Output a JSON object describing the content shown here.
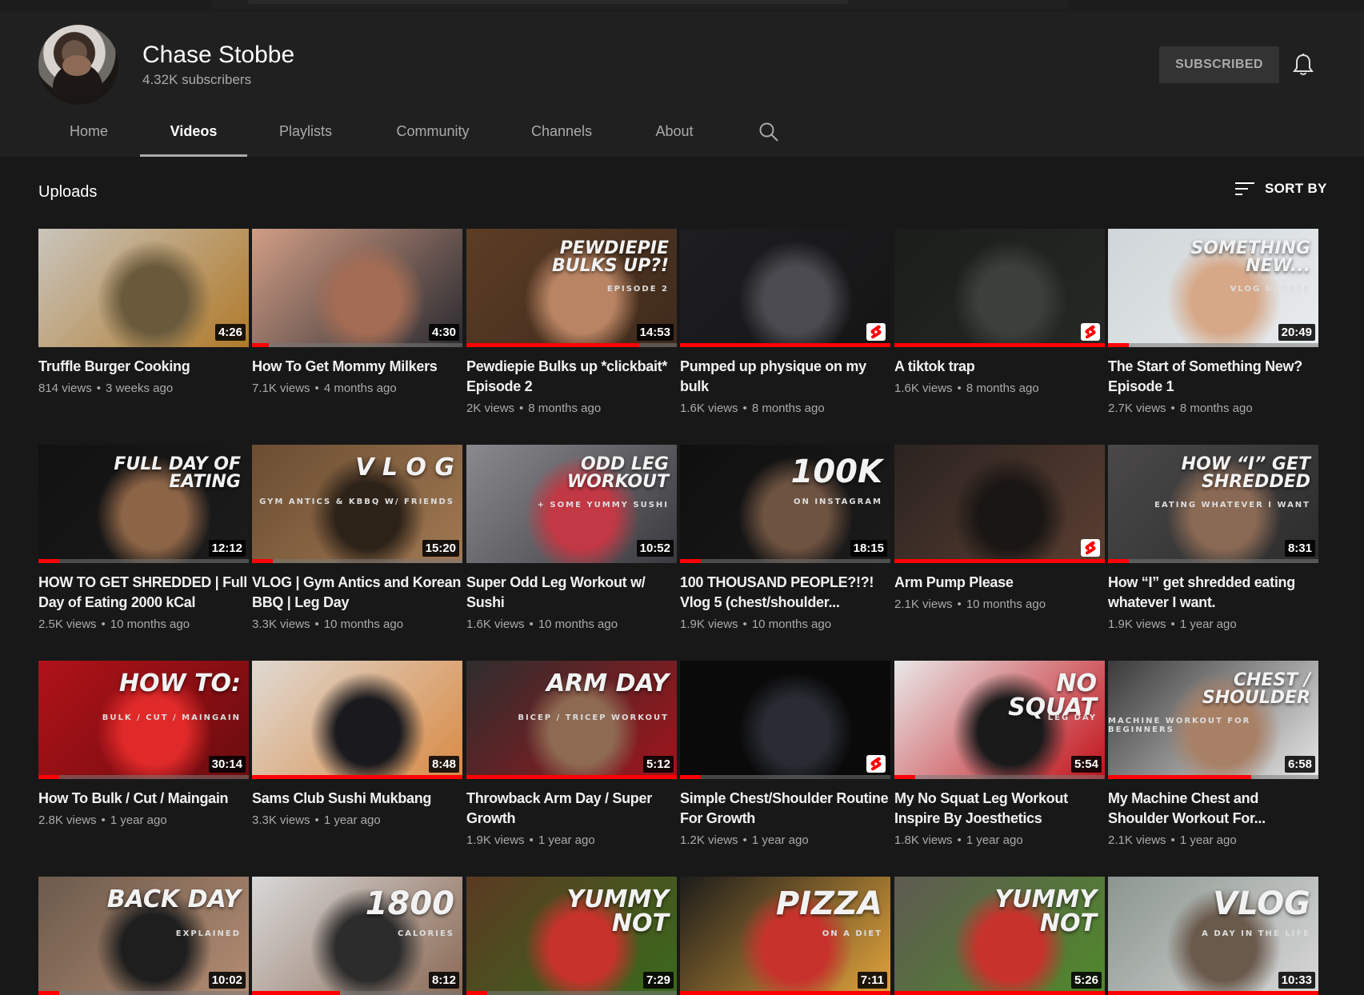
{
  "channel": {
    "name": "Chase Stobbe",
    "subscribers": "4.32K subscribers",
    "subscribe_label": "SUBSCRIBED"
  },
  "tabs": [
    {
      "label": "Home"
    },
    {
      "label": "Videos",
      "active": true
    },
    {
      "label": "Playlists"
    },
    {
      "label": "Community"
    },
    {
      "label": "Channels"
    },
    {
      "label": "About"
    }
  ],
  "section": {
    "title": "Uploads",
    "sort_label": "SORT BY"
  },
  "videos": [
    {
      "title": "Truffle Burger Cooking",
      "views": "814 views",
      "age": "3 weeks ago",
      "duration": "4:26",
      "progress": 0,
      "short": false,
      "caption": "",
      "caption_sub": "",
      "palette": [
        "#c9c4bc",
        "#6a5a3c",
        "#b07a2a"
      ]
    },
    {
      "title": "How To Get Mommy Milkers",
      "views": "7.1K views",
      "age": "4 months ago",
      "duration": "4:30",
      "progress": 0.08,
      "short": false,
      "caption": "",
      "caption_sub": "",
      "palette": [
        "#d19d85",
        "#a46c54",
        "#2a2a30"
      ]
    },
    {
      "title": "Pewdiepie Bulks up *clickbait* Episode 2",
      "views": "2K views",
      "age": "8 months ago",
      "duration": "14:53",
      "progress": 0.82,
      "short": false,
      "caption": "PEWDIEPIE BULKS UP?!",
      "caption_sub": "EPISODE 2",
      "palette": [
        "#5c3d25",
        "#b98464",
        "#3e2a1c"
      ]
    },
    {
      "title": "Pumped up physique on my bulk",
      "views": "1.6K views",
      "age": "8 months ago",
      "duration": "",
      "progress": 1,
      "short": true,
      "caption": "",
      "caption_sub": "",
      "palette": [
        "#1e1e22",
        "#4a4a50",
        "#151515"
      ]
    },
    {
      "title": "A tiktok trap",
      "views": "1.6K views",
      "age": "8 months ago",
      "duration": "",
      "progress": 1,
      "short": true,
      "caption": "",
      "caption_sub": "",
      "palette": [
        "#1b1d1b",
        "#3c3f3a",
        "#262826"
      ]
    },
    {
      "title": "The Start of Something New? Episode 1",
      "views": "2.7K views",
      "age": "8 months ago",
      "duration": "20:49",
      "progress": 0.1,
      "short": false,
      "caption": "SOMETHING NEW...",
      "caption_sub": "VLOG UPDATE",
      "palette": [
        "#cfd5d8",
        "#d6a888",
        "#e9ecee"
      ]
    },
    {
      "title": "HOW TO GET SHREDDED | Full Day of Eating 2000 kCal",
      "views": "2.5K views",
      "age": "10 months ago",
      "duration": "12:12",
      "progress": 0.1,
      "short": false,
      "caption": "FULL DAY OF EATING",
      "caption_sub": "",
      "palette": [
        "#111111",
        "#8c6446",
        "#1c1c1c"
      ]
    },
    {
      "title": "VLOG | Gym Antics and Korean BBQ | Leg Day",
      "views": "3.3K views",
      "age": "10 months ago",
      "duration": "15:20",
      "progress": 0.1,
      "short": false,
      "caption": "V L O G",
      "caption_sub": "GYM ANTICS & KBBQ W/ FRIENDS",
      "palette": [
        "#6b4d32",
        "#2d2218",
        "#a07852"
      ]
    },
    {
      "title": "Super Odd Leg Workout w/ Sushi",
      "views": "1.6K views",
      "age": "10 months ago",
      "duration": "10:52",
      "progress": 0,
      "short": false,
      "caption": "ODD LEG WORKOUT",
      "caption_sub": "+ SOME YUMMY SUSHI",
      "palette": [
        "#8a8a8e",
        "#c23844",
        "#3a3a3e"
      ]
    },
    {
      "title": "100 THOUSAND PEOPLE?!?! Vlog 5 (chest/shoulder...",
      "views": "1.9K views",
      "age": "10 months ago",
      "duration": "18:15",
      "progress": 0.1,
      "short": false,
      "caption": "100K",
      "caption_sub": "ON INSTAGRAM",
      "palette": [
        "#0f0f0f",
        "#6e5341",
        "#1b1b1b"
      ]
    },
    {
      "title": "Arm Pump Please",
      "views": "2.1K views",
      "age": "10 months ago",
      "duration": "",
      "progress": 1,
      "short": true,
      "caption": "",
      "caption_sub": "",
      "palette": [
        "#2b2320",
        "#1a1614",
        "#5a3e32"
      ]
    },
    {
      "title": "How “I” get shredded eating whatever I want.",
      "views": "1.9K views",
      "age": "1 year ago",
      "duration": "8:31",
      "progress": 0.1,
      "short": false,
      "caption": "HOW “I” GET SHREDDED",
      "caption_sub": "EATING WHATEVER I WANT",
      "palette": [
        "#4a4848",
        "#8b6a55",
        "#2c2c2c"
      ]
    },
    {
      "title": "How To Bulk / Cut / Maingain",
      "views": "2.8K views",
      "age": "1 year ago",
      "duration": "30:14",
      "progress": 0.1,
      "short": false,
      "caption": "HOW TO:",
      "caption_sub": "BULK / CUT / MAINGAIN",
      "palette": [
        "#b01218",
        "#e02a2a",
        "#6a0c0f"
      ]
    },
    {
      "title": "Sams Club Sushi Mukbang",
      "views": "3.3K views",
      "age": "1 year ago",
      "duration": "8:48",
      "progress": 1,
      "short": false,
      "caption": "",
      "caption_sub": "",
      "palette": [
        "#dfd9d2",
        "#1a1a1e",
        "#d98a44"
      ]
    },
    {
      "title": "Throwback Arm Day / Super Growth",
      "views": "1.9K views",
      "age": "1 year ago",
      "duration": "5:12",
      "progress": 1,
      "short": false,
      "caption": "ARM DAY",
      "caption_sub": "BICEP / TRICEP WORKOUT",
      "palette": [
        "#2e2e2e",
        "#8e6a52",
        "#a0141b"
      ]
    },
    {
      "title": "Simple Chest/Shoulder Routine For Growth",
      "views": "1.2K views",
      "age": "1 year ago",
      "duration": "",
      "progress": 0.1,
      "short": true,
      "caption": "",
      "caption_sub": "",
      "palette": [
        "#0a0a0a",
        "#2a2c34",
        "#0a0a0a"
      ]
    },
    {
      "title": "My No Squat Leg Workout Inspire By Joesthetics",
      "views": "1.8K views",
      "age": "1 year ago",
      "duration": "5:54",
      "progress": 0.1,
      "short": false,
      "caption": "NO SQUAT",
      "caption_sub": "LEG DAY",
      "palette": [
        "#e8e8e8",
        "#1a1a1a",
        "#c3121a"
      ]
    },
    {
      "title": "My Machine Chest and Shoulder Workout For...",
      "views": "2.1K views",
      "age": "1 year ago",
      "duration": "6:58",
      "progress": 0.68,
      "short": false,
      "caption": "CHEST / SHOULDER",
      "caption_sub": "MACHINE WORKOUT FOR BEGINNERS",
      "palette": [
        "#3a3a3a",
        "#a88066",
        "#e7e7e7"
      ]
    },
    {
      "title": "",
      "views": "",
      "age": "",
      "duration": "10:02",
      "progress": 0.1,
      "short": false,
      "caption": "BACK DAY",
      "caption_sub": "EXPLAINED",
      "palette": [
        "#6b5a4c",
        "#1e1e1e",
        "#b48c72"
      ]
    },
    {
      "title": "",
      "views": "",
      "age": "",
      "duration": "8:12",
      "progress": 0.42,
      "short": false,
      "caption": "1800",
      "caption_sub": "CALORIES",
      "palette": [
        "#d8d8d8",
        "#2c2c2c",
        "#8b6a55"
      ]
    },
    {
      "title": "",
      "views": "",
      "age": "",
      "duration": "7:29",
      "progress": 0.1,
      "short": false,
      "caption": "YUMMY NOT",
      "caption_sub": "",
      "palette": [
        "#5a3a22",
        "#c8322c",
        "#3a6a1c"
      ]
    },
    {
      "title": "",
      "views": "",
      "age": "",
      "duration": "7:11",
      "progress": 1,
      "short": false,
      "caption": "PIZZA",
      "caption_sub": "ON A DIET",
      "palette": [
        "#1c1c1c",
        "#c8322c",
        "#e2a43c"
      ]
    },
    {
      "title": "",
      "views": "",
      "age": "",
      "duration": "5:26",
      "progress": 1,
      "short": false,
      "caption": "YUMMY NOT",
      "caption_sub": "",
      "palette": [
        "#5e5a52",
        "#c8322c",
        "#4f8a2a"
      ]
    },
    {
      "title": "",
      "views": "",
      "age": "",
      "duration": "10:33",
      "progress": 1,
      "short": false,
      "caption": "VLOG",
      "caption_sub": "A DAY IN THE LIFE",
      "palette": [
        "#8c9690",
        "#6a5a4c",
        "#d8d8d8"
      ]
    }
  ]
}
